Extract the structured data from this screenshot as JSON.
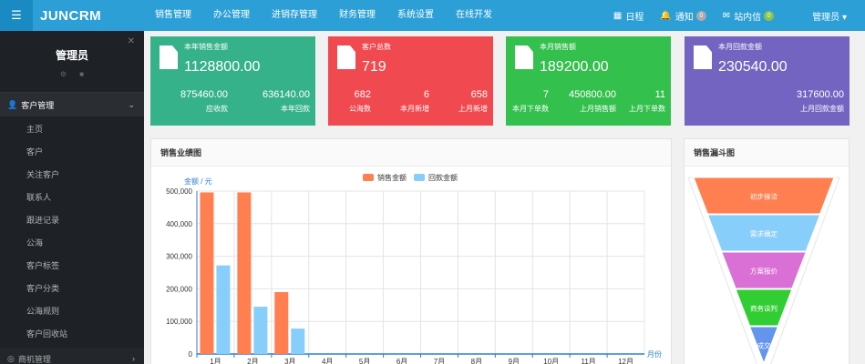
{
  "header": {
    "brand": "JUNCRM",
    "toggle_icon": "menu-toggle-icon",
    "nav": [
      "销售管理",
      "办公管理",
      "进销存管理",
      "财务管理",
      "系统设置",
      "在线开发"
    ],
    "schedule_label": "日程",
    "notify_label": "通知",
    "notify_count": "0",
    "message_label": "站内信",
    "message_count": "0",
    "user_label": "管理员 ▾"
  },
  "sidebar": {
    "user_name": "管理员",
    "section": "客户管理",
    "items": [
      "主页",
      "客户",
      "关注客户",
      "联系人",
      "跟进记录",
      "公海",
      "客户标签",
      "客户分类",
      "公海规则",
      "客户回收站"
    ],
    "section2": "商机管理"
  },
  "cards": [
    {
      "title": "本年销售金额",
      "value": "1128800.00",
      "color": "#35b28a",
      "stats": [
        {
          "value": "875460.00",
          "label": "应收款"
        },
        {
          "value": "636140.00",
          "label": "本年回款"
        }
      ]
    },
    {
      "title": "客户总数",
      "value": "719",
      "color": "#f0494f",
      "stats": [
        {
          "value": "682",
          "label": "公海数"
        },
        {
          "value": "6",
          "label": "本月新增"
        },
        {
          "value": "658",
          "label": "上月新增"
        }
      ]
    },
    {
      "title": "本月销售额",
      "value": "189200.00",
      "color": "#33c04d",
      "stats": [
        {
          "value": "7",
          "label": "本月下单数"
        },
        {
          "value": "450800.00",
          "label": "上月销售额"
        },
        {
          "value": "11",
          "label": "上月下单数"
        }
      ]
    },
    {
      "title": "本月回款金额",
      "value": "230540.00",
      "color": "#7364c1",
      "stats": [
        {
          "value": "317600.00",
          "label": "上月回款金额"
        }
      ]
    }
  ],
  "sales_panel": {
    "title": "销售业绩图"
  },
  "funnel_panel": {
    "title": "销售漏斗图"
  },
  "chart_data": [
    {
      "type": "bar",
      "title": "",
      "ylabel": "金额 / 元",
      "xlabel": "月份",
      "categories": [
        "1月",
        "2月",
        "3月",
        "4月",
        "5月",
        "6月",
        "7月",
        "8月",
        "9月",
        "10月",
        "11月",
        "12月"
      ],
      "ylim": [
        0,
        500000
      ],
      "yticks": [
        "0",
        "100,000",
        "200,000",
        "300,000",
        "400,000",
        "500,000"
      ],
      "grid": true,
      "legend": "top-center",
      "series": [
        {
          "name": "销售金额",
          "color": "#ff7f50",
          "values": [
            496000,
            496000,
            190000,
            0,
            0,
            0,
            0,
            0,
            0,
            0,
            0,
            0
          ]
        },
        {
          "name": "回款金额",
          "color": "#87cefa",
          "values": [
            272000,
            145000,
            78000,
            0,
            0,
            0,
            0,
            0,
            0,
            0,
            0,
            0
          ]
        }
      ]
    },
    {
      "type": "funnel",
      "stages": [
        {
          "label": "初步接洽",
          "color": "#ff7f50"
        },
        {
          "label": "需求确定",
          "color": "#87cefa"
        },
        {
          "label": "方案报价",
          "color": "#da70d6"
        },
        {
          "label": "商务谈判",
          "color": "#32cd32"
        },
        {
          "label": "成交",
          "color": "#6495ed"
        }
      ]
    }
  ]
}
